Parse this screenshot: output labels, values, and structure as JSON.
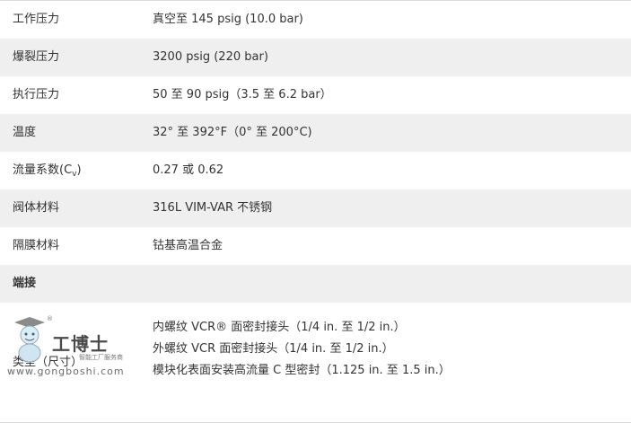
{
  "rows": [
    {
      "label": "工作压力",
      "value": "真空至 145 psig (10.0 bar)"
    },
    {
      "label": "爆裂压力",
      "value": "3200 psig (220 bar)"
    },
    {
      "label": "执行压力",
      "value": "50 至 90 psig（3.5 至 6.2 bar）"
    },
    {
      "label": "温度",
      "value": "32° 至 392°F（0° 至 200°C)"
    },
    {
      "label_main": "流量系数(C",
      "label_sub": "v",
      "label_end": ")",
      "value": "0.27 或 0.62"
    },
    {
      "label": "阀体材料",
      "value": "316L VIM-VAR 不锈钢"
    },
    {
      "label": "隔膜材料",
      "value": "钴基高温合金"
    }
  ],
  "section": {
    "label": "端接"
  },
  "connection": {
    "label": "类型（尺寸）",
    "values": [
      "内螺纹 VCR® 面密封接头（1/4 in. 至 1/2 in.）",
      "外螺纹 VCR 面密封接头（1/4 in. 至 1/2 in.）",
      "模块化表面安装高流量 C 型密封（1.125 in. 至 1.5 in.）"
    ]
  },
  "watermark": {
    "brand": "工博士",
    "tagline": "智能工厂服务商",
    "url": "www.gongboshi.com",
    "reg": "®"
  },
  "colors": {
    "row_shade": "#efefef",
    "text": "#333333",
    "border": "#d9d9d9"
  }
}
